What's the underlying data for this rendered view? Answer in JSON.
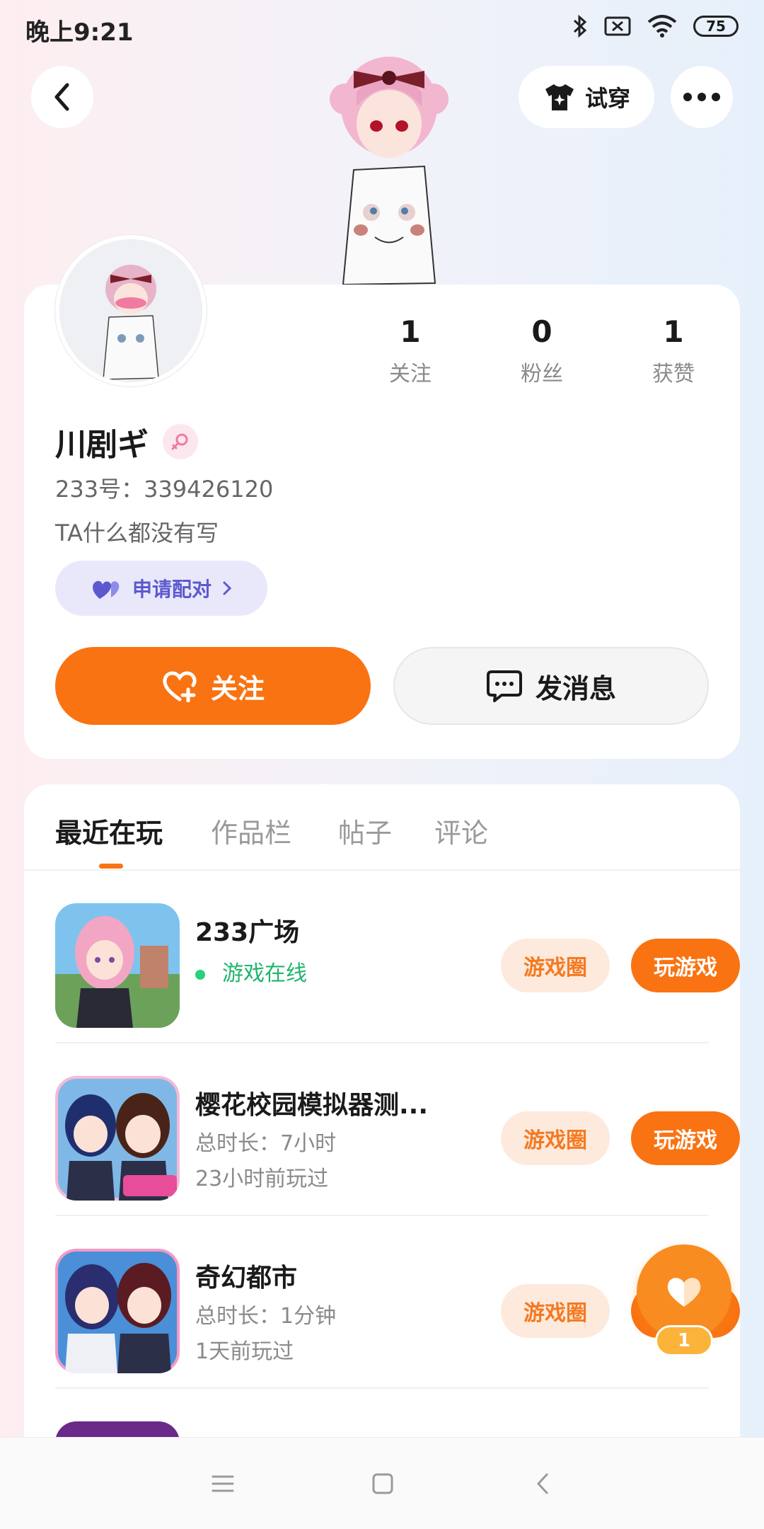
{
  "status_bar": {
    "time": "晚上9:21",
    "battery": "75",
    "icons": [
      "bluetooth-icon",
      "sim-off-icon",
      "wifi-icon",
      "battery-icon"
    ]
  },
  "header": {
    "back_icon": "chevron-left-icon",
    "tryon_label": "试穿",
    "tryon_icon": "tshirt-icon",
    "more_icon": "more-dots-icon"
  },
  "profile": {
    "stats": [
      {
        "value": "1",
        "label": "关注"
      },
      {
        "value": "0",
        "label": "粉丝"
      },
      {
        "value": "1",
        "label": "获赞"
      }
    ],
    "name": "川剧ギ",
    "gender_icon": "female-icon",
    "id_text": "233号：339426120",
    "bio": "TA什么都没有写",
    "pair_label": "申请配对",
    "follow_label": "关注",
    "message_label": "发消息"
  },
  "tabs": [
    {
      "label": "最近在玩",
      "active": true
    },
    {
      "label": "作品栏",
      "active": false
    },
    {
      "label": "帖子",
      "active": false
    },
    {
      "label": "评论",
      "active": false
    }
  ],
  "games": [
    {
      "name": "233广场",
      "line1": "游戏在线",
      "line2": "",
      "online": true,
      "circle_label": "游戏圈",
      "play_label": "玩游戏"
    },
    {
      "name": "樱花校园模拟器测...",
      "line1": "总时长：7小时",
      "line2": "23小时前玩过",
      "online": false,
      "circle_label": "游戏圈",
      "play_label": "玩游戏"
    },
    {
      "name": "奇幻都市",
      "line1": "总时长：1分钟",
      "line2": "1天前玩过",
      "online": false,
      "circle_label": "游戏圈",
      "play_label": "玩"
    }
  ],
  "float_like": {
    "count": "1",
    "icon": "heart-icon"
  },
  "nav_bar": {
    "icons": [
      "menu-icon",
      "home-square-icon",
      "back-arrow-icon"
    ]
  },
  "colors": {
    "accent": "#f97312",
    "online": "#1fb56c",
    "pair": "#5c59cf"
  }
}
